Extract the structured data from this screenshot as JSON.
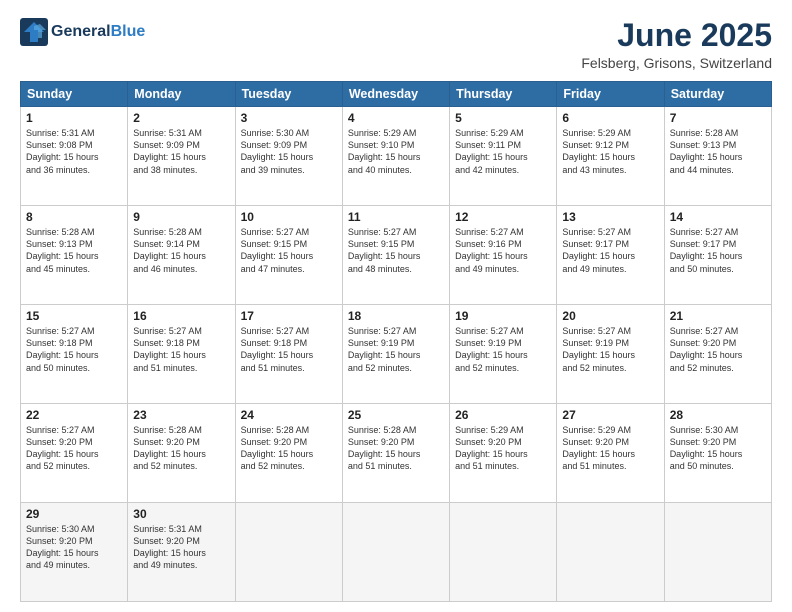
{
  "header": {
    "logo_line1": "General",
    "logo_line2": "Blue",
    "month_title": "June 2025",
    "subtitle": "Felsberg, Grisons, Switzerland"
  },
  "weekdays": [
    "Sunday",
    "Monday",
    "Tuesday",
    "Wednesday",
    "Thursday",
    "Friday",
    "Saturday"
  ],
  "weeks": [
    [
      {
        "day": "1",
        "lines": [
          "Sunrise: 5:31 AM",
          "Sunset: 9:08 PM",
          "Daylight: 15 hours",
          "and 36 minutes."
        ]
      },
      {
        "day": "2",
        "lines": [
          "Sunrise: 5:31 AM",
          "Sunset: 9:09 PM",
          "Daylight: 15 hours",
          "and 38 minutes."
        ]
      },
      {
        "day": "3",
        "lines": [
          "Sunrise: 5:30 AM",
          "Sunset: 9:09 PM",
          "Daylight: 15 hours",
          "and 39 minutes."
        ]
      },
      {
        "day": "4",
        "lines": [
          "Sunrise: 5:29 AM",
          "Sunset: 9:10 PM",
          "Daylight: 15 hours",
          "and 40 minutes."
        ]
      },
      {
        "day": "5",
        "lines": [
          "Sunrise: 5:29 AM",
          "Sunset: 9:11 PM",
          "Daylight: 15 hours",
          "and 42 minutes."
        ]
      },
      {
        "day": "6",
        "lines": [
          "Sunrise: 5:29 AM",
          "Sunset: 9:12 PM",
          "Daylight: 15 hours",
          "and 43 minutes."
        ]
      },
      {
        "day": "7",
        "lines": [
          "Sunrise: 5:28 AM",
          "Sunset: 9:13 PM",
          "Daylight: 15 hours",
          "and 44 minutes."
        ]
      }
    ],
    [
      {
        "day": "8",
        "lines": [
          "Sunrise: 5:28 AM",
          "Sunset: 9:13 PM",
          "Daylight: 15 hours",
          "and 45 minutes."
        ]
      },
      {
        "day": "9",
        "lines": [
          "Sunrise: 5:28 AM",
          "Sunset: 9:14 PM",
          "Daylight: 15 hours",
          "and 46 minutes."
        ]
      },
      {
        "day": "10",
        "lines": [
          "Sunrise: 5:27 AM",
          "Sunset: 9:15 PM",
          "Daylight: 15 hours",
          "and 47 minutes."
        ]
      },
      {
        "day": "11",
        "lines": [
          "Sunrise: 5:27 AM",
          "Sunset: 9:15 PM",
          "Daylight: 15 hours",
          "and 48 minutes."
        ]
      },
      {
        "day": "12",
        "lines": [
          "Sunrise: 5:27 AM",
          "Sunset: 9:16 PM",
          "Daylight: 15 hours",
          "and 49 minutes."
        ]
      },
      {
        "day": "13",
        "lines": [
          "Sunrise: 5:27 AM",
          "Sunset: 9:17 PM",
          "Daylight: 15 hours",
          "and 49 minutes."
        ]
      },
      {
        "day": "14",
        "lines": [
          "Sunrise: 5:27 AM",
          "Sunset: 9:17 PM",
          "Daylight: 15 hours",
          "and 50 minutes."
        ]
      }
    ],
    [
      {
        "day": "15",
        "lines": [
          "Sunrise: 5:27 AM",
          "Sunset: 9:18 PM",
          "Daylight: 15 hours",
          "and 50 minutes."
        ]
      },
      {
        "day": "16",
        "lines": [
          "Sunrise: 5:27 AM",
          "Sunset: 9:18 PM",
          "Daylight: 15 hours",
          "and 51 minutes."
        ]
      },
      {
        "day": "17",
        "lines": [
          "Sunrise: 5:27 AM",
          "Sunset: 9:18 PM",
          "Daylight: 15 hours",
          "and 51 minutes."
        ]
      },
      {
        "day": "18",
        "lines": [
          "Sunrise: 5:27 AM",
          "Sunset: 9:19 PM",
          "Daylight: 15 hours",
          "and 52 minutes."
        ]
      },
      {
        "day": "19",
        "lines": [
          "Sunrise: 5:27 AM",
          "Sunset: 9:19 PM",
          "Daylight: 15 hours",
          "and 52 minutes."
        ]
      },
      {
        "day": "20",
        "lines": [
          "Sunrise: 5:27 AM",
          "Sunset: 9:19 PM",
          "Daylight: 15 hours",
          "and 52 minutes."
        ]
      },
      {
        "day": "21",
        "lines": [
          "Sunrise: 5:27 AM",
          "Sunset: 9:20 PM",
          "Daylight: 15 hours",
          "and 52 minutes."
        ]
      }
    ],
    [
      {
        "day": "22",
        "lines": [
          "Sunrise: 5:27 AM",
          "Sunset: 9:20 PM",
          "Daylight: 15 hours",
          "and 52 minutes."
        ]
      },
      {
        "day": "23",
        "lines": [
          "Sunrise: 5:28 AM",
          "Sunset: 9:20 PM",
          "Daylight: 15 hours",
          "and 52 minutes."
        ]
      },
      {
        "day": "24",
        "lines": [
          "Sunrise: 5:28 AM",
          "Sunset: 9:20 PM",
          "Daylight: 15 hours",
          "and 52 minutes."
        ]
      },
      {
        "day": "25",
        "lines": [
          "Sunrise: 5:28 AM",
          "Sunset: 9:20 PM",
          "Daylight: 15 hours",
          "and 51 minutes."
        ]
      },
      {
        "day": "26",
        "lines": [
          "Sunrise: 5:29 AM",
          "Sunset: 9:20 PM",
          "Daylight: 15 hours",
          "and 51 minutes."
        ]
      },
      {
        "day": "27",
        "lines": [
          "Sunrise: 5:29 AM",
          "Sunset: 9:20 PM",
          "Daylight: 15 hours",
          "and 51 minutes."
        ]
      },
      {
        "day": "28",
        "lines": [
          "Sunrise: 5:30 AM",
          "Sunset: 9:20 PM",
          "Daylight: 15 hours",
          "and 50 minutes."
        ]
      }
    ],
    [
      {
        "day": "29",
        "lines": [
          "Sunrise: 5:30 AM",
          "Sunset: 9:20 PM",
          "Daylight: 15 hours",
          "and 49 minutes."
        ]
      },
      {
        "day": "30",
        "lines": [
          "Sunrise: 5:31 AM",
          "Sunset: 9:20 PM",
          "Daylight: 15 hours",
          "and 49 minutes."
        ]
      },
      {
        "day": "",
        "lines": []
      },
      {
        "day": "",
        "lines": []
      },
      {
        "day": "",
        "lines": []
      },
      {
        "day": "",
        "lines": []
      },
      {
        "day": "",
        "lines": []
      }
    ]
  ]
}
